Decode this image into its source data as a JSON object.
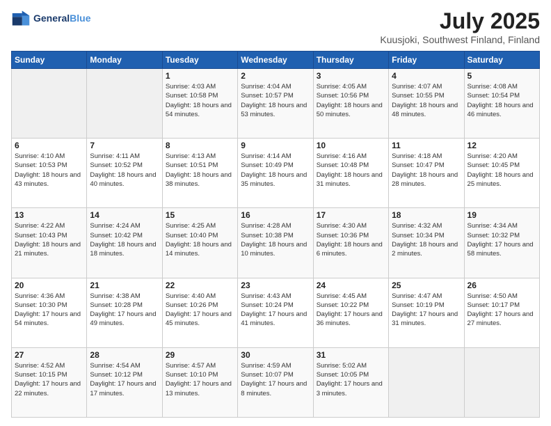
{
  "header": {
    "logo_line1": "General",
    "logo_line2": "Blue",
    "title": "July 2025",
    "subtitle": "Kuusjoki, Southwest Finland, Finland"
  },
  "calendar": {
    "days_of_week": [
      "Sunday",
      "Monday",
      "Tuesday",
      "Wednesday",
      "Thursday",
      "Friday",
      "Saturday"
    ],
    "weeks": [
      [
        {
          "day": "",
          "info": ""
        },
        {
          "day": "",
          "info": ""
        },
        {
          "day": "1",
          "info": "Sunrise: 4:03 AM\nSunset: 10:58 PM\nDaylight: 18 hours and 54 minutes."
        },
        {
          "day": "2",
          "info": "Sunrise: 4:04 AM\nSunset: 10:57 PM\nDaylight: 18 hours and 53 minutes."
        },
        {
          "day": "3",
          "info": "Sunrise: 4:05 AM\nSunset: 10:56 PM\nDaylight: 18 hours and 50 minutes."
        },
        {
          "day": "4",
          "info": "Sunrise: 4:07 AM\nSunset: 10:55 PM\nDaylight: 18 hours and 48 minutes."
        },
        {
          "day": "5",
          "info": "Sunrise: 4:08 AM\nSunset: 10:54 PM\nDaylight: 18 hours and 46 minutes."
        }
      ],
      [
        {
          "day": "6",
          "info": "Sunrise: 4:10 AM\nSunset: 10:53 PM\nDaylight: 18 hours and 43 minutes."
        },
        {
          "day": "7",
          "info": "Sunrise: 4:11 AM\nSunset: 10:52 PM\nDaylight: 18 hours and 40 minutes."
        },
        {
          "day": "8",
          "info": "Sunrise: 4:13 AM\nSunset: 10:51 PM\nDaylight: 18 hours and 38 minutes."
        },
        {
          "day": "9",
          "info": "Sunrise: 4:14 AM\nSunset: 10:49 PM\nDaylight: 18 hours and 35 minutes."
        },
        {
          "day": "10",
          "info": "Sunrise: 4:16 AM\nSunset: 10:48 PM\nDaylight: 18 hours and 31 minutes."
        },
        {
          "day": "11",
          "info": "Sunrise: 4:18 AM\nSunset: 10:47 PM\nDaylight: 18 hours and 28 minutes."
        },
        {
          "day": "12",
          "info": "Sunrise: 4:20 AM\nSunset: 10:45 PM\nDaylight: 18 hours and 25 minutes."
        }
      ],
      [
        {
          "day": "13",
          "info": "Sunrise: 4:22 AM\nSunset: 10:43 PM\nDaylight: 18 hours and 21 minutes."
        },
        {
          "day": "14",
          "info": "Sunrise: 4:24 AM\nSunset: 10:42 PM\nDaylight: 18 hours and 18 minutes."
        },
        {
          "day": "15",
          "info": "Sunrise: 4:25 AM\nSunset: 10:40 PM\nDaylight: 18 hours and 14 minutes."
        },
        {
          "day": "16",
          "info": "Sunrise: 4:28 AM\nSunset: 10:38 PM\nDaylight: 18 hours and 10 minutes."
        },
        {
          "day": "17",
          "info": "Sunrise: 4:30 AM\nSunset: 10:36 PM\nDaylight: 18 hours and 6 minutes."
        },
        {
          "day": "18",
          "info": "Sunrise: 4:32 AM\nSunset: 10:34 PM\nDaylight: 18 hours and 2 minutes."
        },
        {
          "day": "19",
          "info": "Sunrise: 4:34 AM\nSunset: 10:32 PM\nDaylight: 17 hours and 58 minutes."
        }
      ],
      [
        {
          "day": "20",
          "info": "Sunrise: 4:36 AM\nSunset: 10:30 PM\nDaylight: 17 hours and 54 minutes."
        },
        {
          "day": "21",
          "info": "Sunrise: 4:38 AM\nSunset: 10:28 PM\nDaylight: 17 hours and 49 minutes."
        },
        {
          "day": "22",
          "info": "Sunrise: 4:40 AM\nSunset: 10:26 PM\nDaylight: 17 hours and 45 minutes."
        },
        {
          "day": "23",
          "info": "Sunrise: 4:43 AM\nSunset: 10:24 PM\nDaylight: 17 hours and 41 minutes."
        },
        {
          "day": "24",
          "info": "Sunrise: 4:45 AM\nSunset: 10:22 PM\nDaylight: 17 hours and 36 minutes."
        },
        {
          "day": "25",
          "info": "Sunrise: 4:47 AM\nSunset: 10:19 PM\nDaylight: 17 hours and 31 minutes."
        },
        {
          "day": "26",
          "info": "Sunrise: 4:50 AM\nSunset: 10:17 PM\nDaylight: 17 hours and 27 minutes."
        }
      ],
      [
        {
          "day": "27",
          "info": "Sunrise: 4:52 AM\nSunset: 10:15 PM\nDaylight: 17 hours and 22 minutes."
        },
        {
          "day": "28",
          "info": "Sunrise: 4:54 AM\nSunset: 10:12 PM\nDaylight: 17 hours and 17 minutes."
        },
        {
          "day": "29",
          "info": "Sunrise: 4:57 AM\nSunset: 10:10 PM\nDaylight: 17 hours and 13 minutes."
        },
        {
          "day": "30",
          "info": "Sunrise: 4:59 AM\nSunset: 10:07 PM\nDaylight: 17 hours and 8 minutes."
        },
        {
          "day": "31",
          "info": "Sunrise: 5:02 AM\nSunset: 10:05 PM\nDaylight: 17 hours and 3 minutes."
        },
        {
          "day": "",
          "info": ""
        },
        {
          "day": "",
          "info": ""
        }
      ]
    ]
  }
}
